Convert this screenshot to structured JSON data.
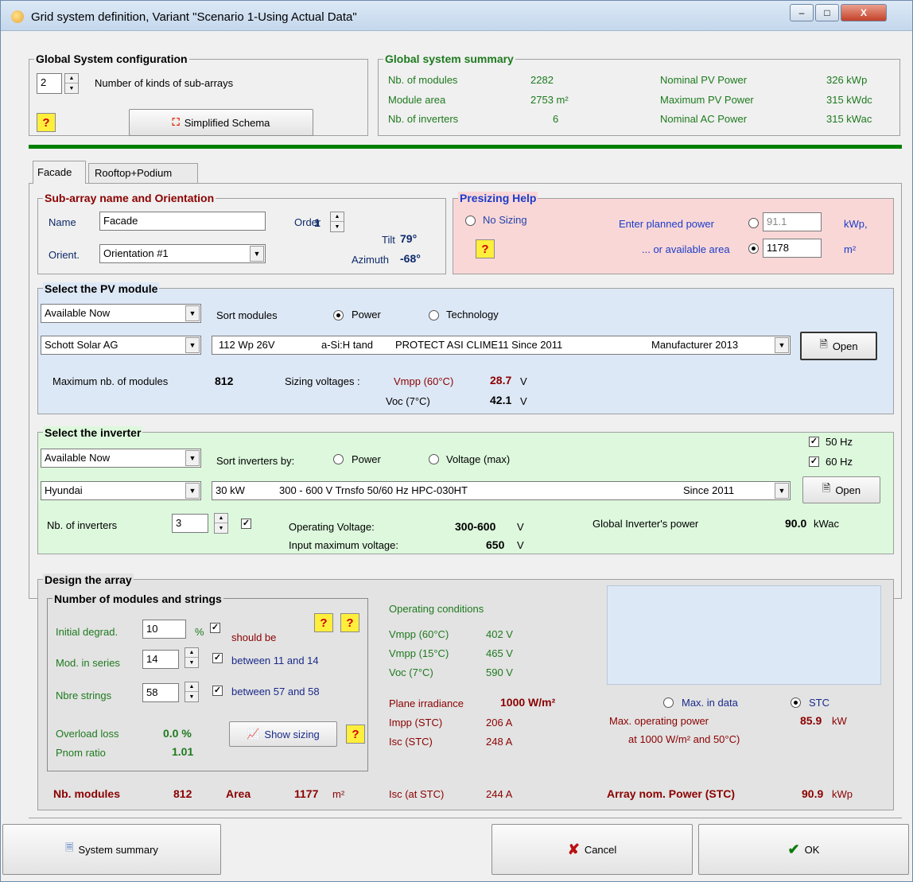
{
  "window": {
    "title": "Grid system definition, Variant  \"Scenario 1-Using Actual Data\"",
    "min": "–",
    "max": "□",
    "close": "X"
  },
  "global_config": {
    "legend": "Global System configuration",
    "kinds_value": "2",
    "kinds_label": "Number of kinds of sub-arrays",
    "schema_button": "Simplified Schema"
  },
  "summary": {
    "legend": "Global system summary",
    "modules_label": "Nb. of modules",
    "modules_value": "2282",
    "area_label": "Module area",
    "area_value": "2753 m²",
    "inverters_label": "Nb. of inverters",
    "inverters_value": "6",
    "nom_pv_label": "Nominal PV Power",
    "nom_pv_value": "326  kWp",
    "max_pv_label": "Maximum PV Power",
    "max_pv_value": "315  kWdc",
    "nom_ac_label": "Nominal AC Power",
    "nom_ac_value": "315  kWac"
  },
  "tabs": [
    "Facade",
    "Rooftop+Podium"
  ],
  "subarray": {
    "legend": "Sub-array name and Orientation",
    "name_label": "Name",
    "name_value": "Facade",
    "order_label": "Order",
    "order_value": "1",
    "orient_label": "Orient.",
    "orient_value": "Orientation #1",
    "tilt_label": "Tilt",
    "tilt_value": "79°",
    "azimuth_label": "Azimuth",
    "azimuth_value": "-68°"
  },
  "presizing": {
    "legend": "Presizing Help",
    "no_sizing": "No Sizing",
    "planned_label": "Enter planned power",
    "planned_value": "91.1",
    "planned_unit": "kWp,",
    "area_label": "... or available area",
    "area_value": "1178",
    "area_unit": "m²"
  },
  "pv": {
    "legend": "Select the PV module",
    "filter": "Available Now",
    "sort_label": "Sort modules",
    "sort_power": "Power",
    "sort_tech": "Technology",
    "manufacturer": "Schott Solar AG",
    "module_power": "112 Wp 26V",
    "module_tech": "a-Si:H tand",
    "module_model": "PROTECT ASI CLIME11  Since 2011",
    "module_source": "Manufacturer 2013",
    "open": "Open",
    "max_label": "Maximum nb. of modules",
    "max_value": "812",
    "sizing_label": "Sizing voltages :",
    "vmpp_label": "Vmpp (60°C)",
    "vmpp_value": "28.7",
    "voc_label": "Voc  (7°C)",
    "voc_value": "42.1",
    "unit_v": "V"
  },
  "inverter": {
    "legend": "Select the inverter",
    "filter": "Available Now",
    "sort_label": "Sort inverters by:",
    "sort_power": "Power",
    "sort_voltage": "Voltage (max)",
    "hz50": "50 Hz",
    "hz60": "60 Hz",
    "manufacturer": "Hyundai",
    "inv_power": "30 kW",
    "inv_desc": "300 - 600 V  Trnsfo  50/60 Hz  HPC-030HT",
    "inv_since": "Since 2011",
    "open": "Open",
    "nb_label": "Nb. of inverters",
    "nb_value": "3",
    "op_label": "Operating Voltage:",
    "op_value": "300-600",
    "in_label": "Input maximum voltage:",
    "in_value": "650",
    "unit_v": "V",
    "global_label": "Global Inverter's power",
    "global_value": "90.0",
    "global_unit": "kWac"
  },
  "design": {
    "legend": "Design the array",
    "sub_legend": "Number of modules and strings",
    "degrad_label": "Initial degrad.",
    "degrad_value": "10",
    "degrad_unit": "%",
    "should_be": "should be",
    "series_label": "Mod. in series",
    "series_value": "14",
    "series_range": "between 11 and 14",
    "strings_label": "Nbre strings",
    "strings_value": "58",
    "strings_range": "between 57 and 58",
    "overload_label": "Overload loss",
    "overload_value": "0.0 %",
    "pnom_label": "Pnom ratio",
    "pnom_value": "1.01",
    "show_sizing": "Show sizing",
    "nb_modules_label": "Nb. modules",
    "nb_modules_value": "812",
    "area_label": "Area",
    "area_value": "1177",
    "area_unit": "m²",
    "op_title": "Operating conditions",
    "vmpp60_label": "Vmpp (60°C)",
    "vmpp60_value": "402 V",
    "vmpp15_label": "Vmpp (15°C)",
    "vmpp15_value": "465 V",
    "voc7_label": "Voc  (7°C)",
    "voc7_value": "590 V",
    "irr_label": "Plane irradiance",
    "irr_value": "1000 W/m²",
    "impp_label": "Impp (STC)",
    "impp_value": "206 A",
    "isc_label": "Isc  (STC)",
    "isc_value": "248 A",
    "isc_at_label": "Isc (at STC)",
    "isc_at_value": "244 A",
    "max_in_data": "Max. in data",
    "stc": "STC",
    "max_op_label": "Max. operating power",
    "max_op_cond": "at 1000 W/m² and 50°C)",
    "max_op_value": "85.9",
    "max_op_unit": "kW",
    "nom_power_label": "Array nom. Power (STC)",
    "nom_power_value": "90.9",
    "nom_power_unit": "kWp"
  },
  "footer": {
    "summary": "System summary",
    "cancel": "Cancel",
    "ok": "OK"
  },
  "colors": {
    "pv_bg": "#dde8f6",
    "inv_bg": "#ddf8dd",
    "presize_bg": "#fad7d7",
    "separator": "#008000"
  }
}
